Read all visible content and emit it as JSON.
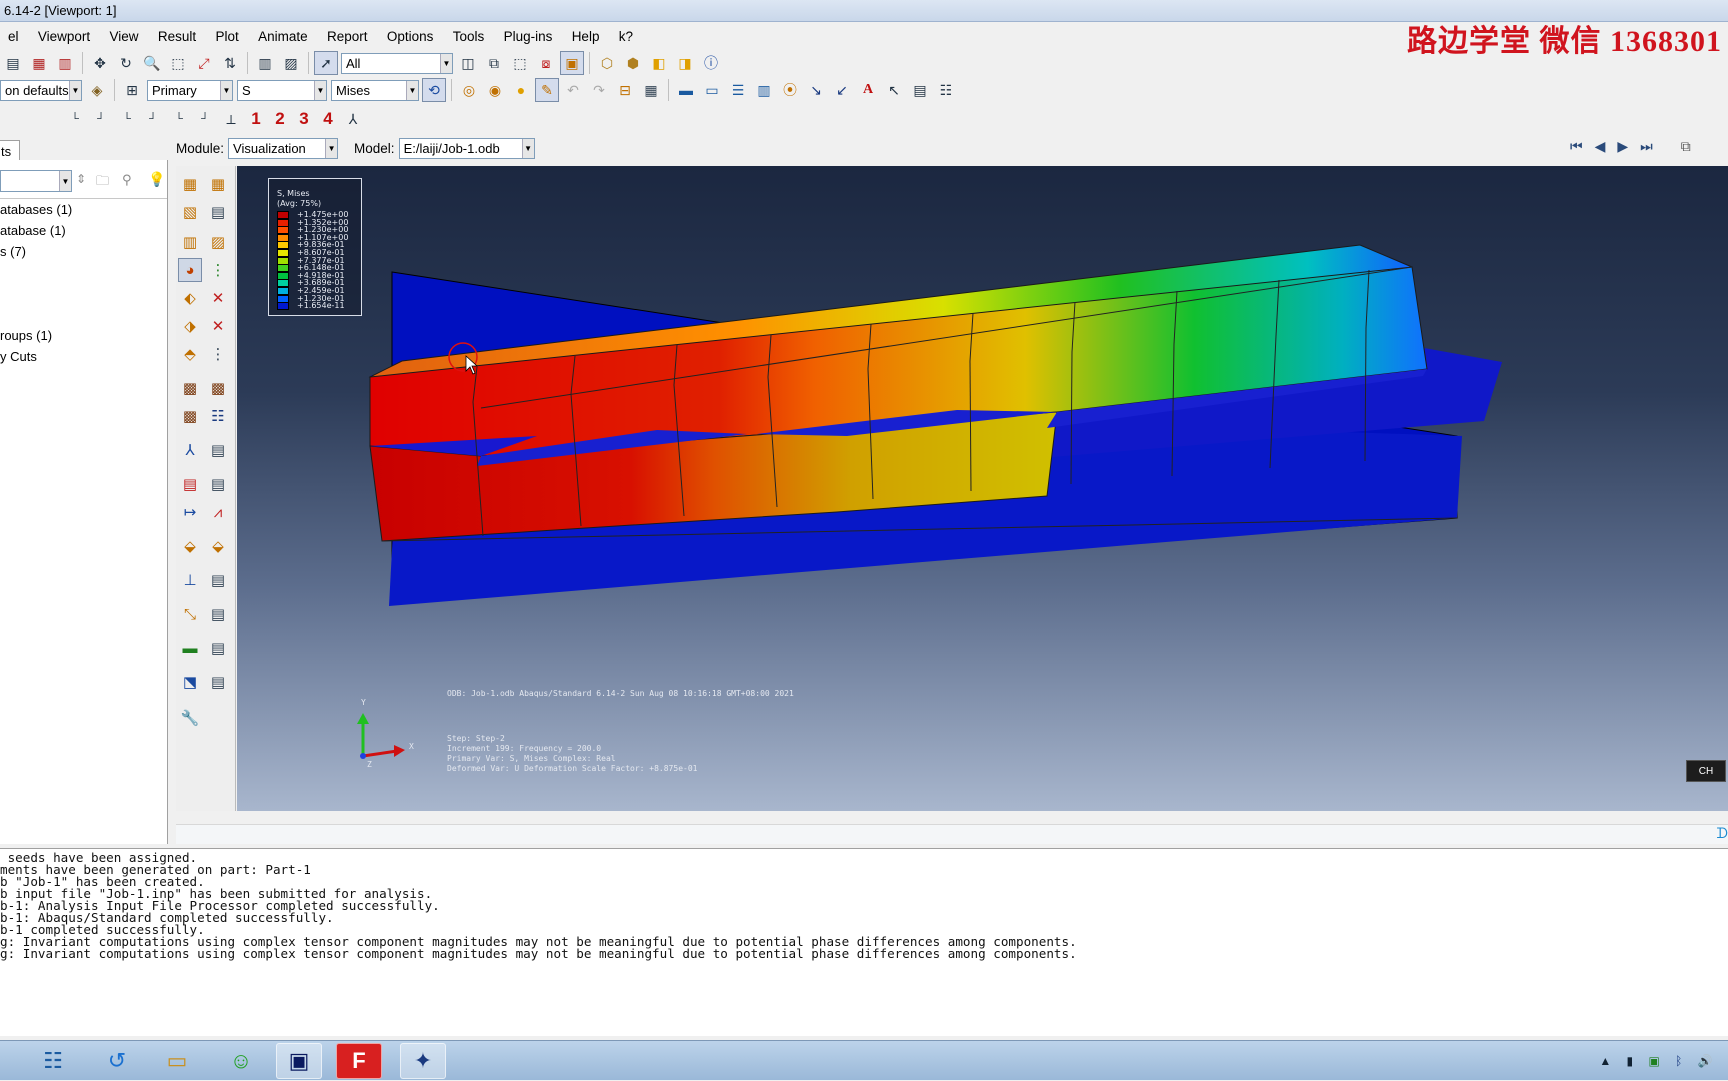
{
  "window": {
    "title": "6.14-2 [Viewport: 1]"
  },
  "watermark": "路边学堂  微信  1368301",
  "menu": [
    "el",
    "Viewport",
    "View",
    "Result",
    "Plot",
    "Animate",
    "Report",
    "Options",
    "Tools",
    "Plug-ins",
    "Help",
    "k?"
  ],
  "toolbar1": {
    "selection_filter": "All"
  },
  "toolbar2": {
    "defaults": "on defaults",
    "field_kind": "Primary",
    "field_var": "S",
    "invariant": "Mises"
  },
  "toolbar3": {
    "numbers": [
      "1",
      "2",
      "3",
      "4"
    ]
  },
  "modelbar": {
    "module_label": "Module:",
    "module_value": "Visualization",
    "model_label": "Model:",
    "model_value": "E:/laiji/Job-1.odb"
  },
  "left_panel": {
    "tab": "ts",
    "tree": [
      "atabases (1)",
      "atabase (1)",
      "s (7)",
      "roups (1)",
      "y Cuts"
    ]
  },
  "legend": {
    "title": "S, Mises",
    "subtitle": "(Avg: 75%)",
    "values": [
      "+1.475e+00",
      "+1.352e+00",
      "+1.230e+00",
      "+1.107e+00",
      "+9.836e-01",
      "+8.607e-01",
      "+7.377e-01",
      "+6.148e-01",
      "+4.918e-01",
      "+3.689e-01",
      "+2.459e-01",
      "+1.230e-01",
      "+1.654e-11"
    ],
    "colors": [
      "#c00000",
      "#e82000",
      "#ff5000",
      "#ff8c00",
      "#ffc800",
      "#e6e600",
      "#a0e000",
      "#40d020",
      "#00c040",
      "#00d0a0",
      "#00b0e0",
      "#0060ff",
      "#0018d0"
    ]
  },
  "viewport": {
    "odb_line": "ODB: Job-1.odb    Abaqus/Standard 6.14-2    Sun Aug 08 10:16:18 GMT+08:00 2021",
    "step": "Step: Step-2",
    "increment": "Increment    199: Frequency =    200.0",
    "primary_var": "Primary Var: S, Mises   Complex: Real",
    "deformed_var": "Deformed Var: U   Deformation Scale Factor: +8.875e-01",
    "axis_x": "X",
    "axis_y": "Y",
    "axis_z": "Z"
  },
  "ch_badge": "CH",
  "console_lines": [
    " seeds have been assigned.",
    "ments have been generated on part: Part-1",
    "b \"Job-1\" has been created.",
    "b input file \"Job-1.inp\" has been submitted for analysis.",
    "b-1: Analysis Input File Processor completed successfully.",
    "b-1: Abaqus/Standard completed successfully.",
    "b-1 completed successfully.",
    "g: Invariant computations using complex tensor component magnitudes may not be meaningful due to potential phase differences among components.",
    "g: Invariant computations using complex tensor component magnitudes may not be meaningful due to potential phase differences among components."
  ],
  "taskbar": {
    "apps": [
      "start-menu",
      "refresh",
      "file-explorer",
      "wechat",
      "image-viewer",
      "foxit-reader",
      "abaqus"
    ]
  }
}
